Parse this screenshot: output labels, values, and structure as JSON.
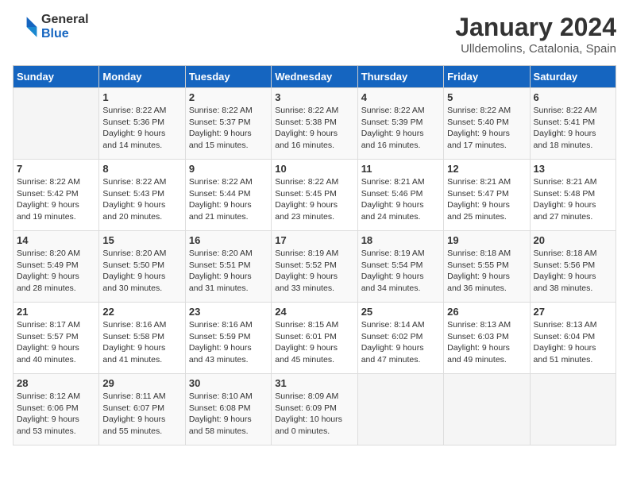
{
  "header": {
    "logo_line1": "General",
    "logo_line2": "Blue",
    "month": "January 2024",
    "location": "Ulldemolins, Catalonia, Spain"
  },
  "days_of_week": [
    "Sunday",
    "Monday",
    "Tuesday",
    "Wednesday",
    "Thursday",
    "Friday",
    "Saturday"
  ],
  "weeks": [
    [
      {
        "day": "",
        "content": ""
      },
      {
        "day": "1",
        "content": "Sunrise: 8:22 AM\nSunset: 5:36 PM\nDaylight: 9 hours\nand 14 minutes."
      },
      {
        "day": "2",
        "content": "Sunrise: 8:22 AM\nSunset: 5:37 PM\nDaylight: 9 hours\nand 15 minutes."
      },
      {
        "day": "3",
        "content": "Sunrise: 8:22 AM\nSunset: 5:38 PM\nDaylight: 9 hours\nand 16 minutes."
      },
      {
        "day": "4",
        "content": "Sunrise: 8:22 AM\nSunset: 5:39 PM\nDaylight: 9 hours\nand 16 minutes."
      },
      {
        "day": "5",
        "content": "Sunrise: 8:22 AM\nSunset: 5:40 PM\nDaylight: 9 hours\nand 17 minutes."
      },
      {
        "day": "6",
        "content": "Sunrise: 8:22 AM\nSunset: 5:41 PM\nDaylight: 9 hours\nand 18 minutes."
      }
    ],
    [
      {
        "day": "7",
        "content": "Sunrise: 8:22 AM\nSunset: 5:42 PM\nDaylight: 9 hours\nand 19 minutes."
      },
      {
        "day": "8",
        "content": "Sunrise: 8:22 AM\nSunset: 5:43 PM\nDaylight: 9 hours\nand 20 minutes."
      },
      {
        "day": "9",
        "content": "Sunrise: 8:22 AM\nSunset: 5:44 PM\nDaylight: 9 hours\nand 21 minutes."
      },
      {
        "day": "10",
        "content": "Sunrise: 8:22 AM\nSunset: 5:45 PM\nDaylight: 9 hours\nand 23 minutes."
      },
      {
        "day": "11",
        "content": "Sunrise: 8:21 AM\nSunset: 5:46 PM\nDaylight: 9 hours\nand 24 minutes."
      },
      {
        "day": "12",
        "content": "Sunrise: 8:21 AM\nSunset: 5:47 PM\nDaylight: 9 hours\nand 25 minutes."
      },
      {
        "day": "13",
        "content": "Sunrise: 8:21 AM\nSunset: 5:48 PM\nDaylight: 9 hours\nand 27 minutes."
      }
    ],
    [
      {
        "day": "14",
        "content": "Sunrise: 8:20 AM\nSunset: 5:49 PM\nDaylight: 9 hours\nand 28 minutes."
      },
      {
        "day": "15",
        "content": "Sunrise: 8:20 AM\nSunset: 5:50 PM\nDaylight: 9 hours\nand 30 minutes."
      },
      {
        "day": "16",
        "content": "Sunrise: 8:20 AM\nSunset: 5:51 PM\nDaylight: 9 hours\nand 31 minutes."
      },
      {
        "day": "17",
        "content": "Sunrise: 8:19 AM\nSunset: 5:52 PM\nDaylight: 9 hours\nand 33 minutes."
      },
      {
        "day": "18",
        "content": "Sunrise: 8:19 AM\nSunset: 5:54 PM\nDaylight: 9 hours\nand 34 minutes."
      },
      {
        "day": "19",
        "content": "Sunrise: 8:18 AM\nSunset: 5:55 PM\nDaylight: 9 hours\nand 36 minutes."
      },
      {
        "day": "20",
        "content": "Sunrise: 8:18 AM\nSunset: 5:56 PM\nDaylight: 9 hours\nand 38 minutes."
      }
    ],
    [
      {
        "day": "21",
        "content": "Sunrise: 8:17 AM\nSunset: 5:57 PM\nDaylight: 9 hours\nand 40 minutes."
      },
      {
        "day": "22",
        "content": "Sunrise: 8:16 AM\nSunset: 5:58 PM\nDaylight: 9 hours\nand 41 minutes."
      },
      {
        "day": "23",
        "content": "Sunrise: 8:16 AM\nSunset: 5:59 PM\nDaylight: 9 hours\nand 43 minutes."
      },
      {
        "day": "24",
        "content": "Sunrise: 8:15 AM\nSunset: 6:01 PM\nDaylight: 9 hours\nand 45 minutes."
      },
      {
        "day": "25",
        "content": "Sunrise: 8:14 AM\nSunset: 6:02 PM\nDaylight: 9 hours\nand 47 minutes."
      },
      {
        "day": "26",
        "content": "Sunrise: 8:13 AM\nSunset: 6:03 PM\nDaylight: 9 hours\nand 49 minutes."
      },
      {
        "day": "27",
        "content": "Sunrise: 8:13 AM\nSunset: 6:04 PM\nDaylight: 9 hours\nand 51 minutes."
      }
    ],
    [
      {
        "day": "28",
        "content": "Sunrise: 8:12 AM\nSunset: 6:06 PM\nDaylight: 9 hours\nand 53 minutes."
      },
      {
        "day": "29",
        "content": "Sunrise: 8:11 AM\nSunset: 6:07 PM\nDaylight: 9 hours\nand 55 minutes."
      },
      {
        "day": "30",
        "content": "Sunrise: 8:10 AM\nSunset: 6:08 PM\nDaylight: 9 hours\nand 58 minutes."
      },
      {
        "day": "31",
        "content": "Sunrise: 8:09 AM\nSunset: 6:09 PM\nDaylight: 10 hours\nand 0 minutes."
      },
      {
        "day": "",
        "content": ""
      },
      {
        "day": "",
        "content": ""
      },
      {
        "day": "",
        "content": ""
      }
    ]
  ]
}
